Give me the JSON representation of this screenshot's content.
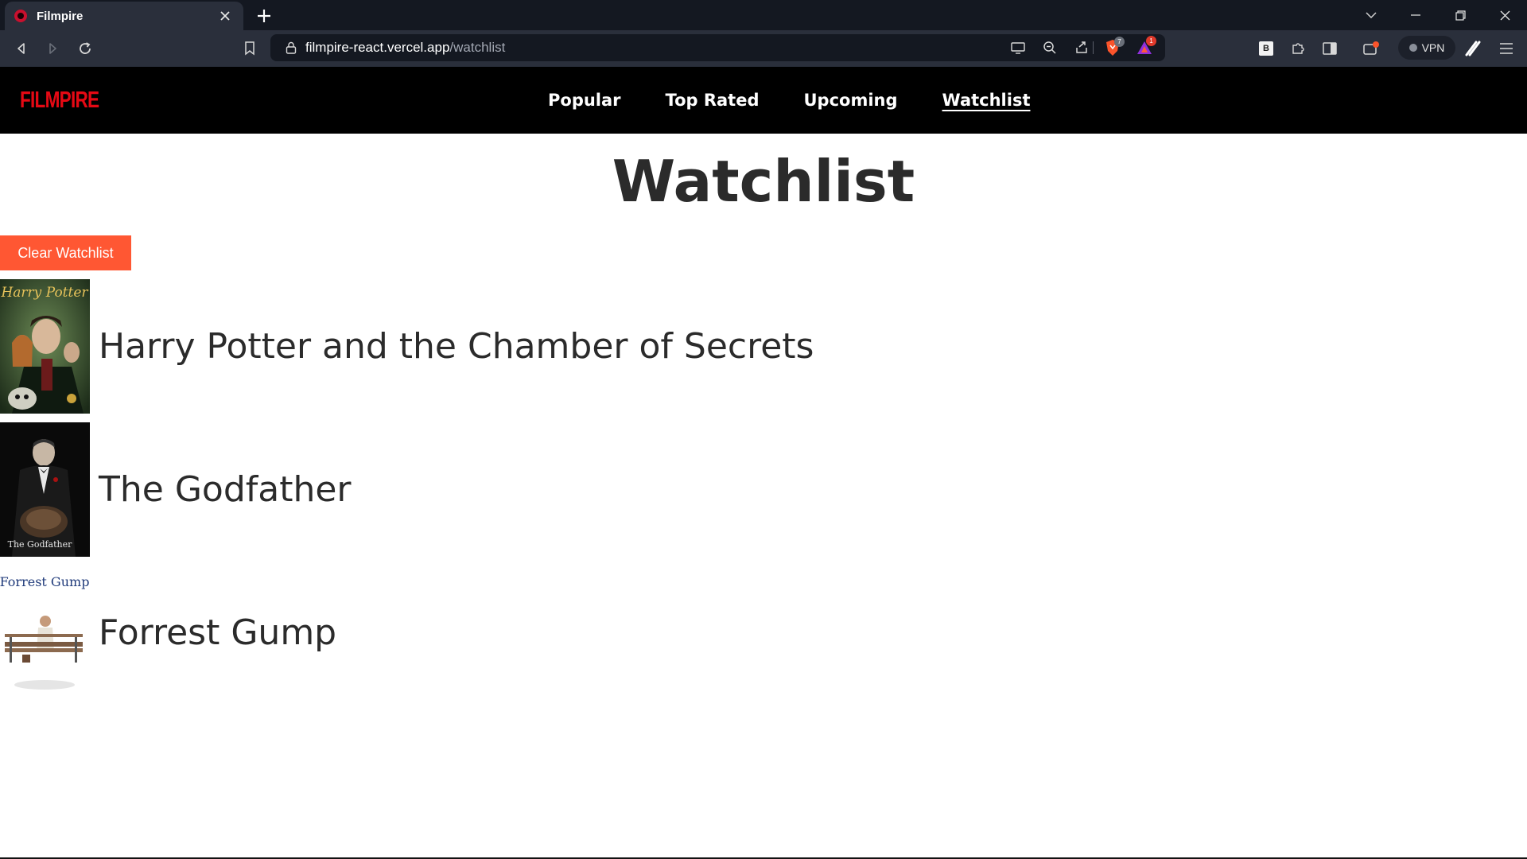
{
  "browser": {
    "tab_title": "Filmpire",
    "url_host": "filmpire-react.vercel.app",
    "url_path": "/watchlist",
    "brave_badge": "7",
    "rewards_badge": "1",
    "vpn_label": "VPN",
    "ext_label": "B"
  },
  "app": {
    "logo": "FILMPIRE",
    "nav": [
      {
        "label": "Popular"
      },
      {
        "label": "Top Rated"
      },
      {
        "label": "Upcoming"
      },
      {
        "label": "Watchlist"
      }
    ]
  },
  "page": {
    "title": "Watchlist",
    "clear_button": "Clear Watchlist"
  },
  "watchlist": [
    {
      "title": "Harry Potter and the Chamber of Secrets",
      "poster_text": "Harry Potter"
    },
    {
      "title": "The Godfather",
      "poster_text": "The Godfather"
    },
    {
      "title": "Forrest Gump",
      "poster_text": "Forrest Gump"
    }
  ],
  "colors": {
    "logo": "#e50914",
    "clear_button": "#ff5733",
    "nav_bg": "#000000"
  }
}
